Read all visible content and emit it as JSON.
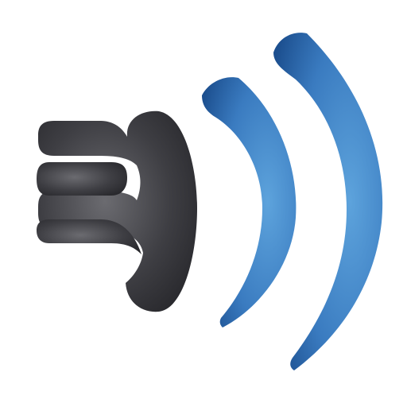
{
  "icon": {
    "name": "speaker-volume-icon",
    "background": "#ffffff",
    "speaker_color_light": "#6b6b70",
    "speaker_color_dark": "#2b2b2f",
    "wave_color_light": "#5da3dc",
    "wave_color_dark": "#1c4f8f"
  }
}
